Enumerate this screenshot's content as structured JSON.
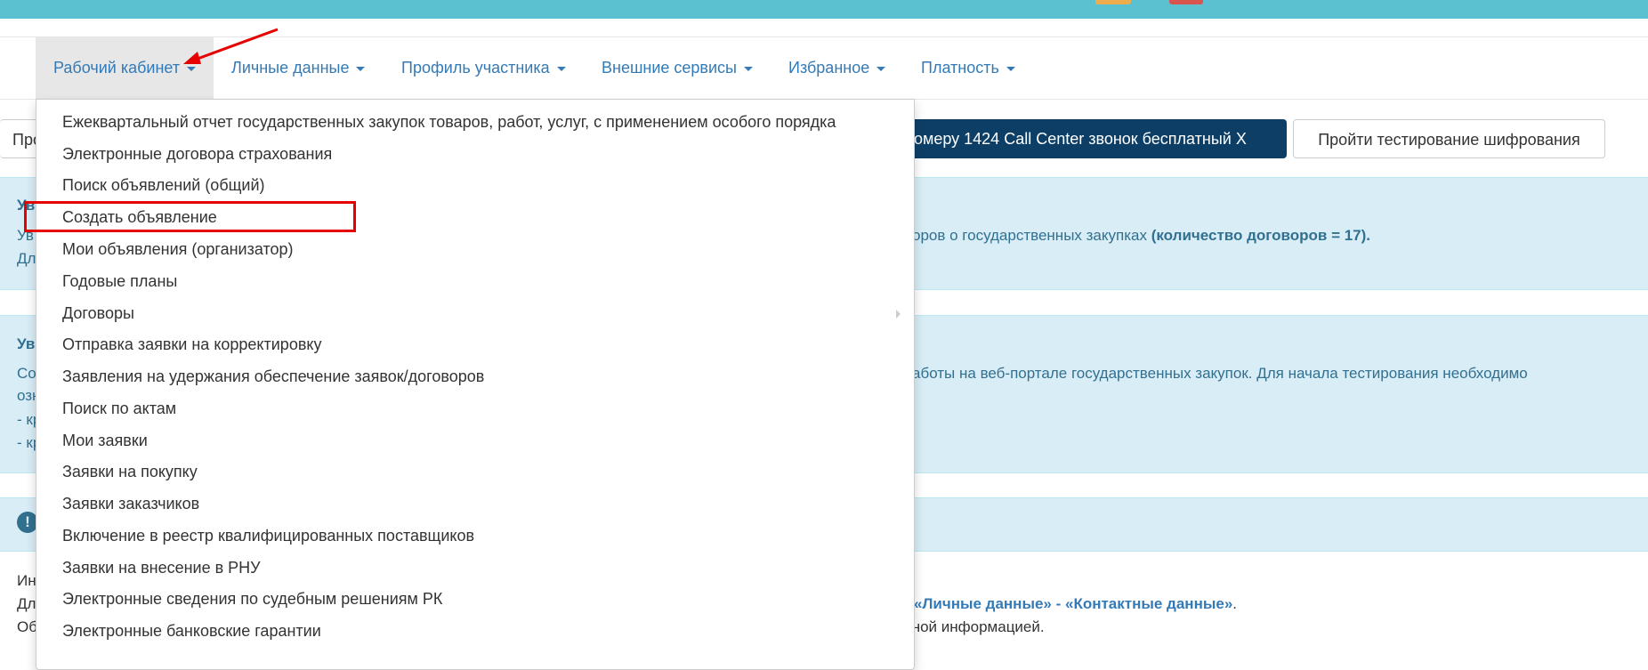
{
  "nav": {
    "items": [
      {
        "label": "Рабочий кабинет"
      },
      {
        "label": "Личные данные"
      },
      {
        "label": "Профиль участника"
      },
      {
        "label": "Внешние сервисы"
      },
      {
        "label": "Избранное"
      },
      {
        "label": "Платность"
      }
    ]
  },
  "buttons": {
    "left_partial": "Про",
    "call_center": "номеру 1424 Call Center звонок бесплатный X",
    "test_encryption": "Пройти тестирование шифрования"
  },
  "panel1": {
    "title_partial": "Ув",
    "line1_left": "Ув",
    "line1_right": "оров о государственных закупках",
    "line1_bold": "(количество договоров = 17).",
    "line2_left": "Дл"
  },
  "panel2": {
    "title_partial": "Ув",
    "line1_left": "Со",
    "line1_right": "аботы на веб-портале государственных закупок. Для начала тестирования необходимо",
    "line2_left": "озн",
    "line3_left": "- кр",
    "line4_left": "- кр"
  },
  "panel3": {
    "icon": "exclamation-circle-icon"
  },
  "info": {
    "line1_left": "Ин",
    "line2_left": "Дл",
    "line2_link1": "«Личные данные»",
    "line2_sep": " - ",
    "line2_link2": "«Контактные данные»",
    "line2_end": ".",
    "line3_left": "Об",
    "line3_right": "упной информацией."
  },
  "dropdown": {
    "items": [
      "Ежеквартальный отчет государственных закупок товаров, работ, услуг, с применением особого порядка",
      "Электронные договора страхования",
      "Поиск объявлений (общий)",
      "Создать объявление",
      "Мои объявления (организатор)",
      "Годовые планы",
      "Договоры",
      "Отправка заявки на корректировку",
      "Заявления на удержания обеспечение заявок/договоров",
      "Поиск по актам",
      "Мои заявки",
      "Заявки на покупку",
      "Заявки заказчиков",
      "Включение в реестр квалифицированных поставщиков",
      "Заявки на внесение в РНУ",
      "Электронные сведения по судебным решениям РК",
      "Электронные банковские гарантии"
    ]
  },
  "colors": {
    "accent": "#337ab7",
    "topbar": "#5bc0cf",
    "info_panel": "#d9edf7",
    "dark_button": "#0d3f66",
    "highlight": "#e60000"
  }
}
